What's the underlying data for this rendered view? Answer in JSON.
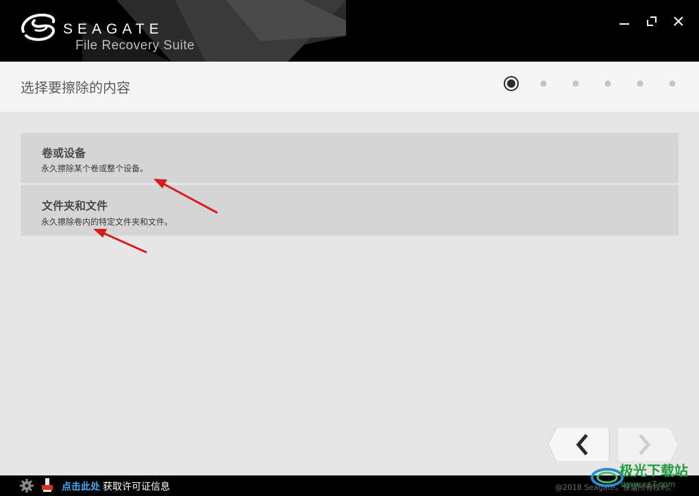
{
  "header": {
    "brand": "SEAGATE",
    "product": "File Recovery Suite",
    "window_controls": [
      "minimize-icon",
      "maximize-icon",
      "close-icon"
    ]
  },
  "page": {
    "title": "选择要擦除的内容",
    "steps_total": 6,
    "current_step": 1
  },
  "options": [
    {
      "title": "卷或设备",
      "description": "永久擦除某个卷或整个设备。"
    },
    {
      "title": "文件夹和文件",
      "description": "永久擦除卷内的特定文件夹和文件。"
    }
  ],
  "navigation": {
    "back_icon": "chevron-left-icon",
    "next_icon": "chevron-right-icon"
  },
  "footer": {
    "license_link": "点击此处",
    "license_text": "获取许可证信息",
    "copyright": "@2018 Seagate。保留所有权利。"
  },
  "watermark": {
    "text": "极光下载站",
    "url": "www.xz7.com"
  },
  "colors": {
    "header_bg": "#000000",
    "link": "#3fa9f5",
    "annotation_arrow": "#d91c1c"
  }
}
